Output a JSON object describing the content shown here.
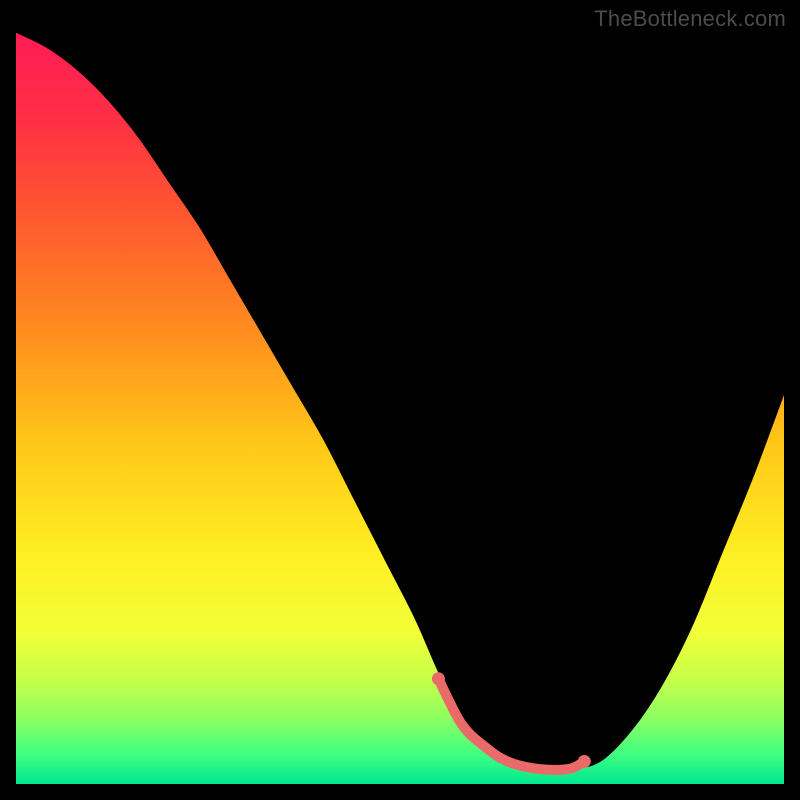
{
  "watermark": "TheBottleneck.com",
  "chart_data": {
    "type": "line",
    "title": "",
    "xlabel": "",
    "ylabel": "",
    "xlim": [
      0,
      100
    ],
    "ylim": [
      0,
      100
    ],
    "background": {
      "stops": [
        {
          "offset": 0.0,
          "color": "#ff1b56"
        },
        {
          "offset": 0.12,
          "color": "#ff3044"
        },
        {
          "offset": 0.25,
          "color": "#ff5a2e"
        },
        {
          "offset": 0.4,
          "color": "#ff8e1e"
        },
        {
          "offset": 0.55,
          "color": "#ffc818"
        },
        {
          "offset": 0.7,
          "color": "#fff024"
        },
        {
          "offset": 0.8,
          "color": "#f0ff38"
        },
        {
          "offset": 0.86,
          "color": "#c8ff4a"
        },
        {
          "offset": 0.91,
          "color": "#90ff60"
        },
        {
          "offset": 0.96,
          "color": "#40ff80"
        },
        {
          "offset": 1.0,
          "color": "#00e890"
        }
      ]
    },
    "series": [
      {
        "name": "bottleneck-curve",
        "color": "#000000",
        "x": [
          0,
          4,
          8,
          12,
          16,
          20,
          24,
          28,
          32,
          36,
          40,
          44,
          48,
          52,
          55,
          58,
          61,
          64,
          68,
          72,
          76,
          80,
          84,
          88,
          92,
          96,
          100
        ],
        "values": [
          100,
          98,
          95,
          91,
          86,
          80,
          74,
          67,
          60,
          53,
          46,
          38,
          30,
          22,
          15,
          9,
          5,
          3,
          2,
          2,
          3,
          7,
          13,
          21,
          31,
          41,
          52
        ]
      },
      {
        "name": "optimal-segment",
        "color": "#ea6a6a",
        "x": [
          55,
          58,
          61,
          64,
          68,
          72,
          74
        ],
        "values": [
          14,
          8,
          5,
          3,
          2,
          2,
          3
        ]
      }
    ],
    "markers": [
      {
        "name": "range-start-dot",
        "x": 55,
        "y": 14,
        "color": "#ea6a6a"
      },
      {
        "name": "range-end-dot",
        "x": 74,
        "y": 3,
        "color": "#ea6a6a"
      }
    ]
  }
}
